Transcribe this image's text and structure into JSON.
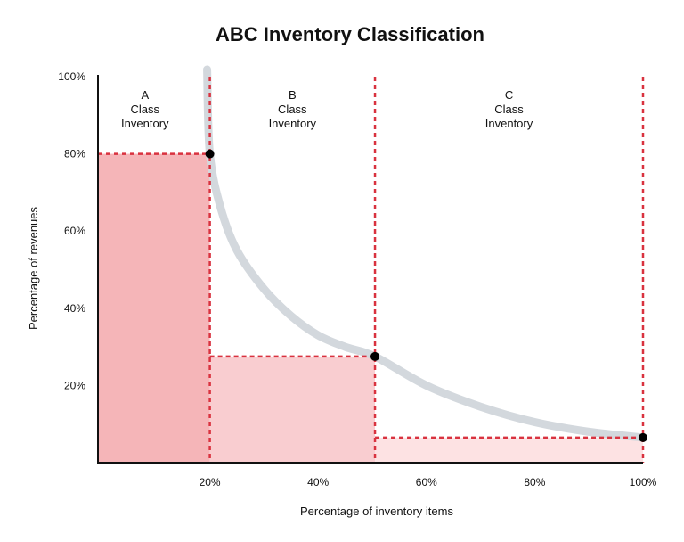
{
  "chart_data": {
    "type": "area",
    "title": "ABC Inventory Classification",
    "xlabel": "Percentage of inventory items",
    "ylabel": "Percentage of revenues",
    "xlim": [
      0,
      100
    ],
    "ylim": [
      0,
      100
    ],
    "x_ticks": [
      {
        "value": 20,
        "label": "20%"
      },
      {
        "value": 40,
        "label": "40%"
      },
      {
        "value": 60,
        "label": "60%"
      },
      {
        "value": 80,
        "label": "80%"
      },
      {
        "value": 100,
        "label": "100%"
      }
    ],
    "y_ticks": [
      {
        "value": 20,
        "label": "20%"
      },
      {
        "value": 40,
        "label": "40%"
      },
      {
        "value": 60,
        "label": "60%"
      },
      {
        "value": 80,
        "label": "80%"
      },
      {
        "value": 100,
        "label": "100%"
      }
    ],
    "grid": false,
    "classes": [
      {
        "name": "A",
        "line1": "A",
        "line2": "Class",
        "line3": "Inventory",
        "x_start": 0,
        "x_end": 20,
        "revenue": 80,
        "color": "#f5b5b8"
      },
      {
        "name": "B",
        "line1": "B",
        "line2": "Class",
        "line3": "Inventory",
        "x_start": 20,
        "x_end": 50.5,
        "revenue": 27.5,
        "color": "#f9cdd0"
      },
      {
        "name": "C",
        "line1": "C",
        "line2": "Class",
        "line3": "Inventory",
        "x_start": 50.5,
        "x_end": 100,
        "revenue": 6.5,
        "color": "#fde2e3"
      }
    ],
    "points": [
      {
        "x": 20,
        "y": 80
      },
      {
        "x": 50.5,
        "y": 27.5
      },
      {
        "x": 100,
        "y": 6.5
      }
    ],
    "curve": {
      "description": "decreasing curve through class boundary points",
      "x": [
        19.5,
        20,
        22,
        25,
        30,
        35,
        40,
        45,
        50.5,
        60,
        70,
        80,
        90,
        100
      ],
      "y": [
        100,
        80,
        66,
        55,
        45,
        38,
        33,
        30,
        27.5,
        20,
        14.5,
        10.5,
        8,
        6.5
      ],
      "color": "#d3d8dd"
    },
    "dashed_line_color": "#d9323f",
    "axis_color": "#111111",
    "point_color": "#000000"
  }
}
